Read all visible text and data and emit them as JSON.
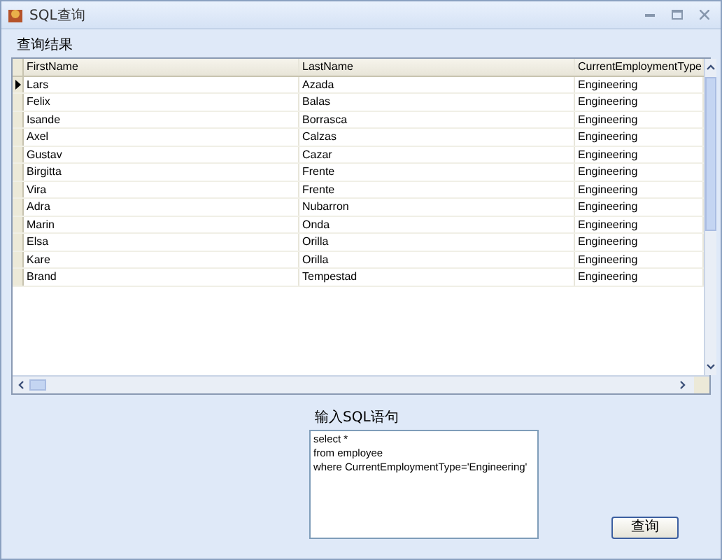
{
  "window": {
    "title": "SQL查询"
  },
  "results_label": "查询结果",
  "table": {
    "columns": [
      "FirstName",
      "LastName",
      "CurrentEmploymentType"
    ],
    "rows": [
      {
        "cells": [
          "Lars",
          "Azada",
          "Engineering"
        ],
        "selected": true
      },
      {
        "cells": [
          "Felix",
          "Balas",
          "Engineering"
        ],
        "selected": false
      },
      {
        "cells": [
          "Isande",
          "Borrasca",
          "Engineering"
        ],
        "selected": false
      },
      {
        "cells": [
          "Axel",
          "Calzas",
          "Engineering"
        ],
        "selected": false
      },
      {
        "cells": [
          "Gustav",
          "Cazar",
          "Engineering"
        ],
        "selected": false
      },
      {
        "cells": [
          "Birgitta",
          "Frente",
          "Engineering"
        ],
        "selected": false
      },
      {
        "cells": [
          "Vira",
          "Frente",
          "Engineering"
        ],
        "selected": false
      },
      {
        "cells": [
          "Adra",
          "Nubarron",
          "Engineering"
        ],
        "selected": false
      },
      {
        "cells": [
          "Marin",
          "Onda",
          "Engineering"
        ],
        "selected": false
      },
      {
        "cells": [
          "Elsa",
          "Orilla",
          "Engineering"
        ],
        "selected": false
      },
      {
        "cells": [
          "Kare",
          "Orilla",
          "Engineering"
        ],
        "selected": false
      },
      {
        "cells": [
          "Brand",
          "Tempestad",
          "Engineering"
        ],
        "selected": false
      }
    ]
  },
  "sql_label": "输入SQL语句",
  "sql_input": {
    "value": "select *\nfrom employee\nwhere CurrentEmploymentType='Engineering'"
  },
  "buttons": [
    "查询"
  ]
}
